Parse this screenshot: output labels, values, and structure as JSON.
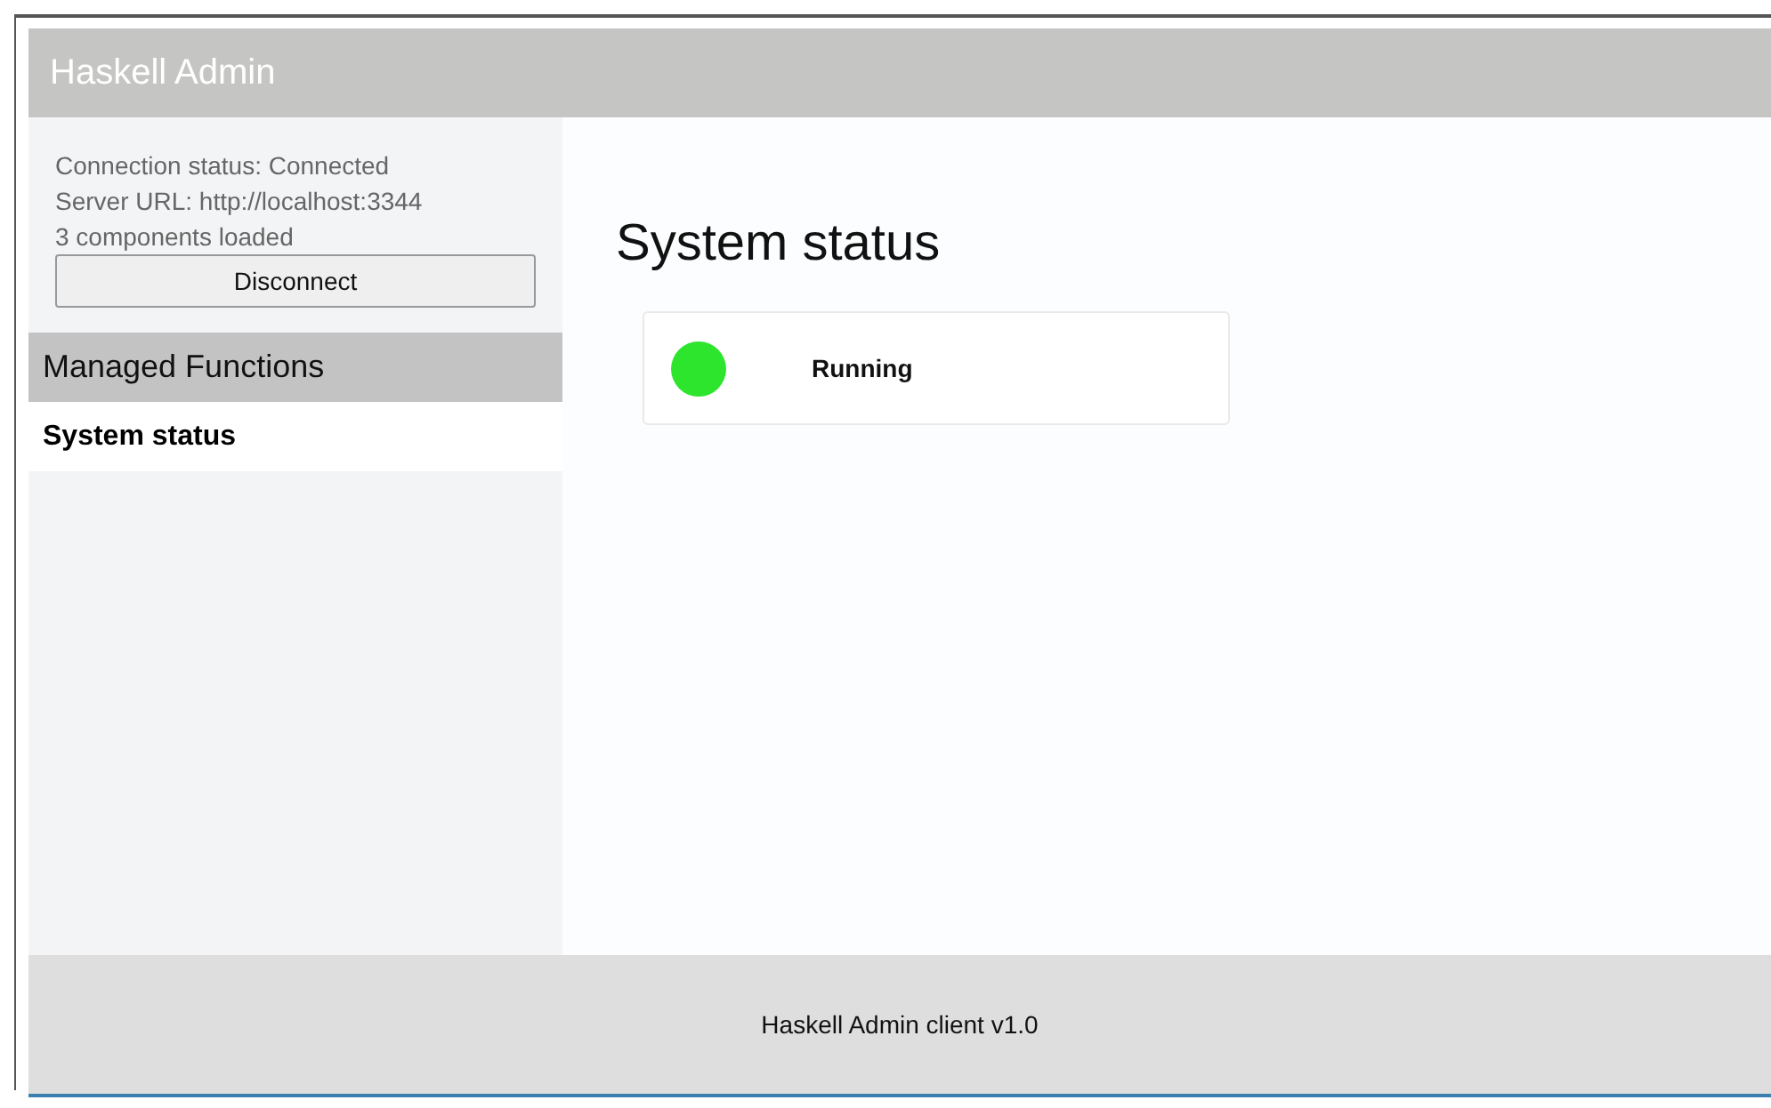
{
  "header": {
    "title": "Haskell Admin"
  },
  "connection": {
    "lines": [
      "Connection status: Connected",
      "Server URL: http://localhost:3344",
      "3 components loaded"
    ],
    "button": "Disconnect"
  },
  "sidebar": {
    "section": "Managed Functions",
    "items": [
      {
        "label": "System status",
        "selected": true
      }
    ]
  },
  "main": {
    "heading": "System status",
    "status": {
      "label": "Running",
      "color": "#2ee52e"
    }
  },
  "footer": {
    "text": "Haskell Admin client v1.0"
  }
}
